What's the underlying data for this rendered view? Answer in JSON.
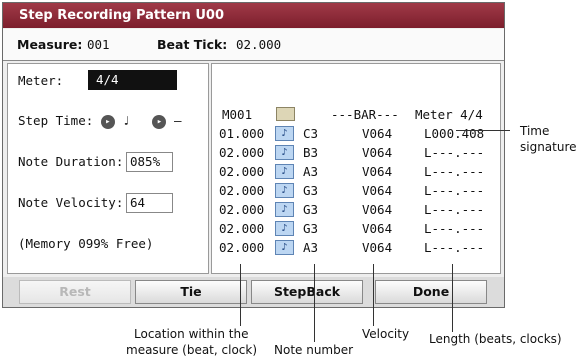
{
  "window": {
    "title": "Step Recording Pattern U00",
    "measure_label": "Measure:",
    "measure_value": "001",
    "beat_tick_label": "Beat Tick:",
    "beat_tick_value": "02.000"
  },
  "left_panel": {
    "meter_label": "Meter:",
    "meter_value": "4/4",
    "step_time_label": "Step Time:",
    "step_time_note": "♩",
    "step_time_mod": "–",
    "note_duration_label": "Note Duration:",
    "note_duration_value": "085%",
    "note_velocity_label": "Note Velocity:",
    "note_velocity_value": "64",
    "memory_text": "(Memory  099% Free)"
  },
  "event_list": {
    "header": {
      "measure": "M001",
      "bar": "---BAR---",
      "meter": "Meter 4/4"
    },
    "rows": [
      {
        "location": "01.000",
        "icon": "♪",
        "note": "C3",
        "velocity": "V064",
        "length": "L000.408"
      },
      {
        "location": "02.000",
        "icon": "♪",
        "note": "B3",
        "velocity": "V064",
        "length": "L---.---"
      },
      {
        "location": "02.000",
        "icon": "♪",
        "note": "A3",
        "velocity": "V064",
        "length": "L---.---"
      },
      {
        "location": "02.000",
        "icon": "♪",
        "note": "G3",
        "velocity": "V064",
        "length": "L---.---"
      },
      {
        "location": "02.000",
        "icon": "♪",
        "note": "G3",
        "velocity": "V064",
        "length": "L---.---"
      },
      {
        "location": "02.000",
        "icon": "♪",
        "note": "G3",
        "velocity": "V064",
        "length": "L---.---"
      },
      {
        "location": "02.000",
        "icon": "♪",
        "note": "A3",
        "velocity": "V064",
        "length": "L---.---"
      }
    ]
  },
  "buttons": {
    "rest": "Rest",
    "tie": "Tie",
    "stepback": "StepBack",
    "done": "Done"
  },
  "callouts": {
    "time_signature_1": "Time",
    "time_signature_2": "signature",
    "location_1": "Location within the",
    "location_2": "measure (beat, clock)",
    "note_number": "Note number",
    "velocity": "Velocity",
    "length": "Length (beats, clocks)"
  }
}
